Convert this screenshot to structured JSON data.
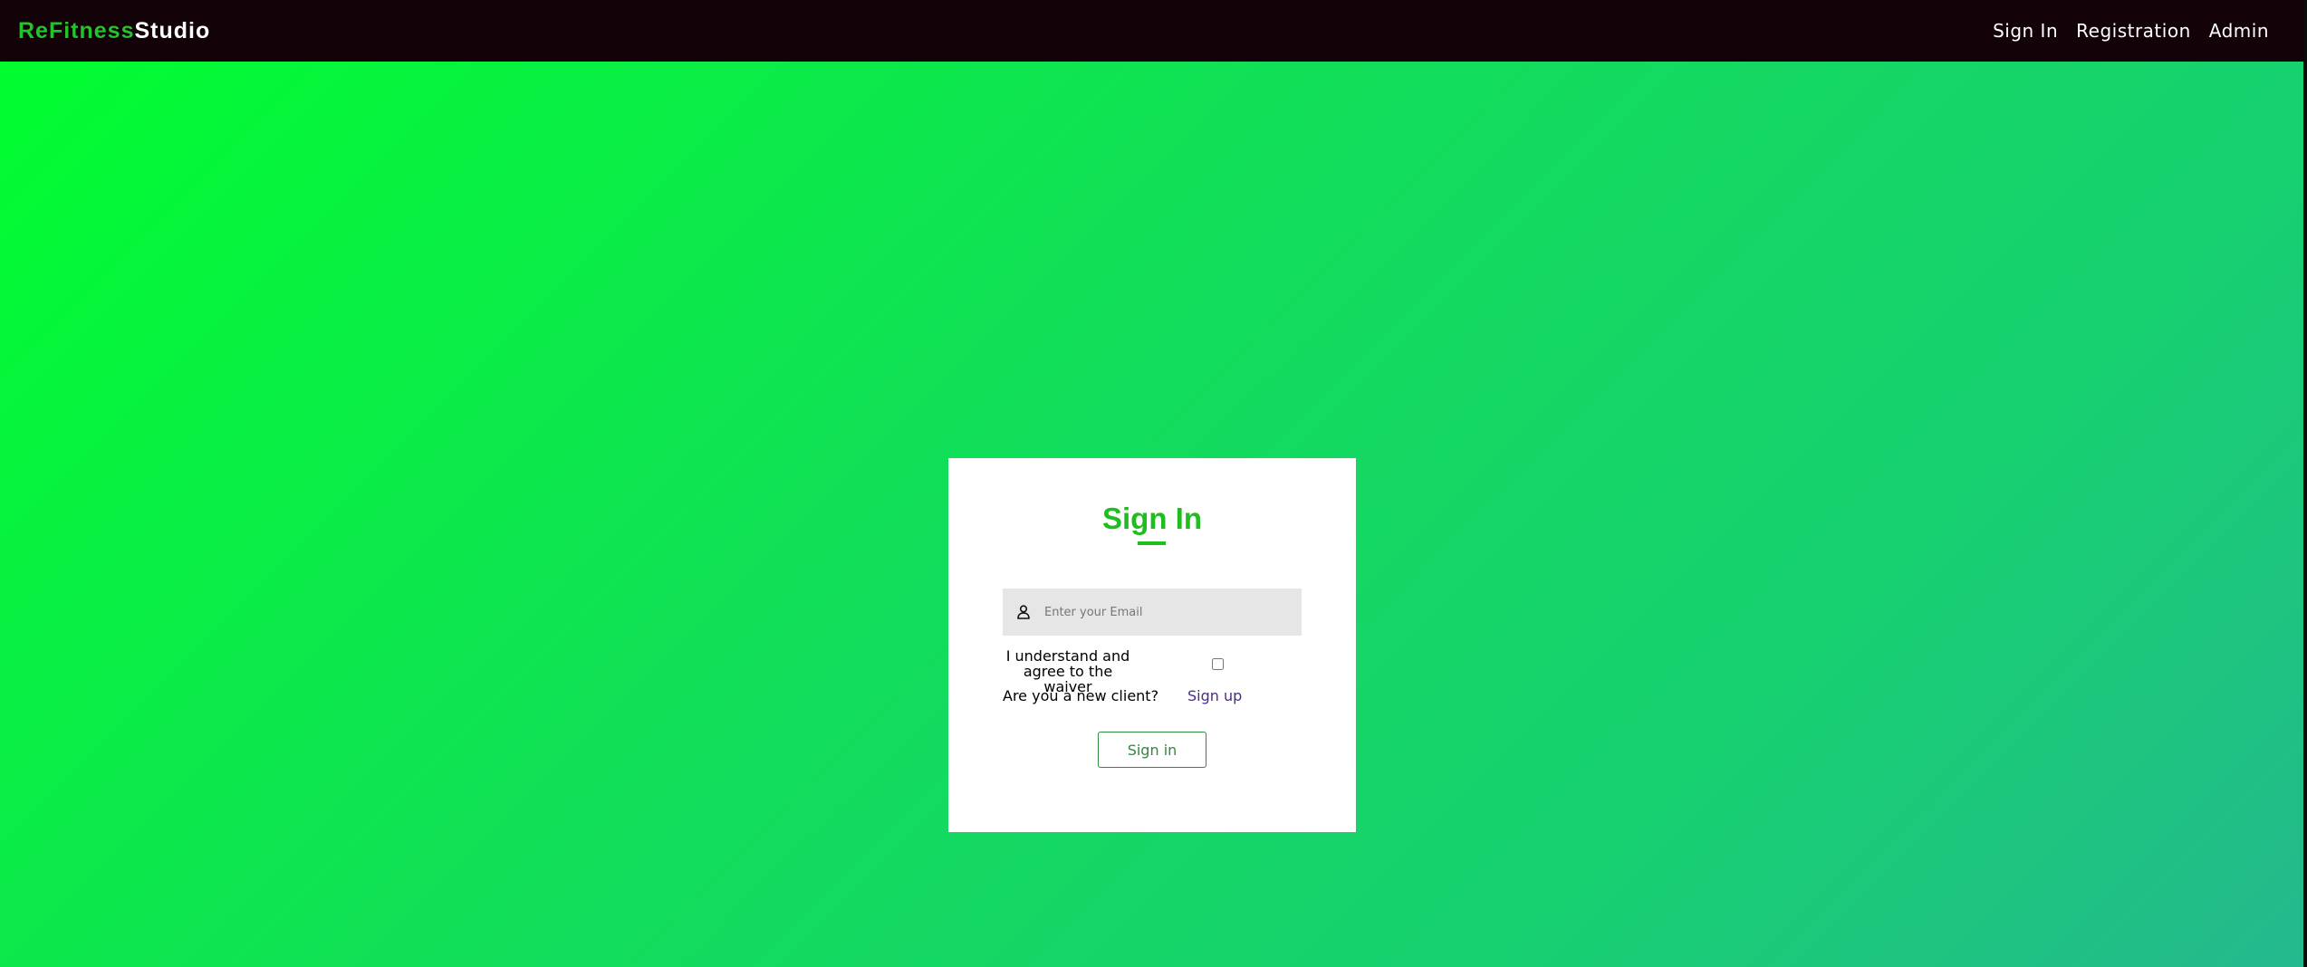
{
  "navbar": {
    "brand_part1": "ReFitness",
    "brand_part2": "Studio",
    "links": [
      "Sign In",
      "Registration",
      "Admin"
    ]
  },
  "signin_card": {
    "title": "Sign In",
    "email_placeholder": "Enter your Email",
    "email_icon": "user-icon",
    "waiver_label": "I understand and agree to the waiver",
    "waiver_checked": false,
    "new_client_text": "Are you a new client?",
    "signup_link": "Sign up",
    "signin_button": "Sign in"
  },
  "colors": {
    "navbar_bg": "#130207",
    "brand_accent": "#23c32c",
    "title_green": "#1fbe1f",
    "button_green": "#2e8b3e",
    "link_purple": "#4a2a8c",
    "background_gradient_start": "#00ff2e",
    "background_gradient_end": "#24b98e"
  }
}
